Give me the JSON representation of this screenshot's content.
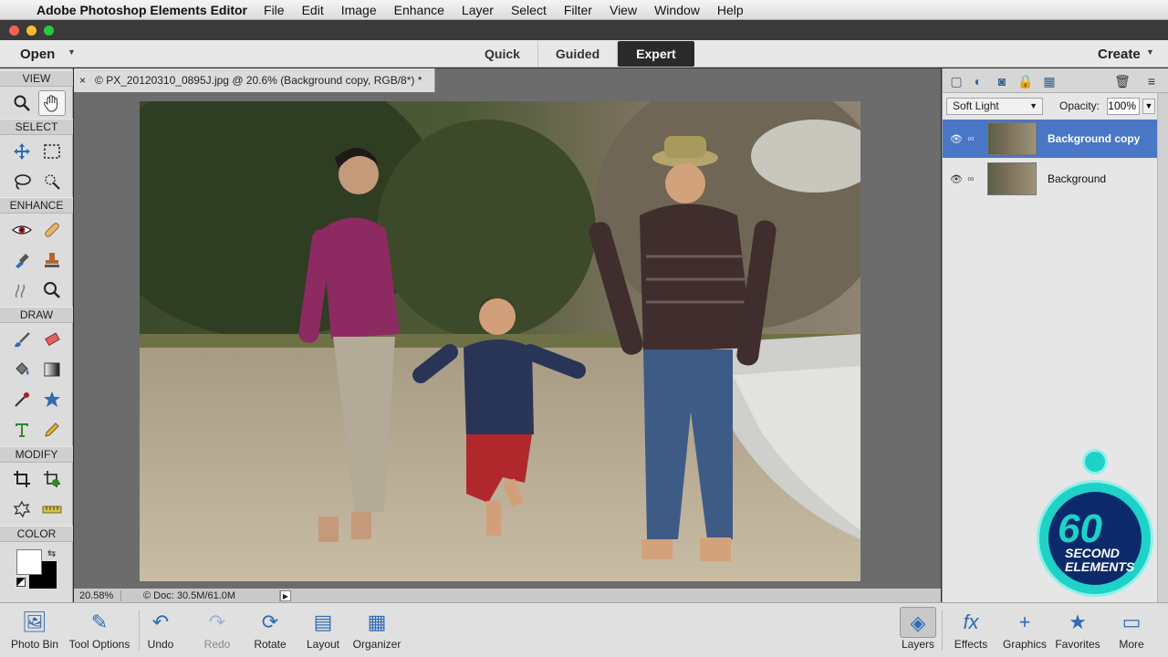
{
  "menubar": {
    "app_name": "Adobe Photoshop Elements Editor",
    "items": [
      "File",
      "Edit",
      "Image",
      "Enhance",
      "Layer",
      "Select",
      "Filter",
      "View",
      "Window",
      "Help"
    ]
  },
  "modebar": {
    "open_label": "Open",
    "modes": [
      "Quick",
      "Guided",
      "Expert"
    ],
    "active_mode": "Expert",
    "create_label": "Create"
  },
  "toolpanel": {
    "sections": {
      "view": "VIEW",
      "select": "SELECT",
      "enhance": "ENHANCE",
      "draw": "DRAW",
      "modify": "MODIFY",
      "color": "COLOR"
    }
  },
  "document": {
    "tab_title": "© PX_20120310_0895J.jpg @ 20.6% (Background copy, RGB/8*) *",
    "zoom": "20.58%",
    "doc_info": "© Doc: 30.5M/61.0M"
  },
  "layers": {
    "blend_mode": "Soft Light",
    "opacity_label": "Opacity:",
    "opacity_value": "100%",
    "items": [
      {
        "name": "Background copy",
        "selected": true
      },
      {
        "name": "Background",
        "selected": false
      }
    ]
  },
  "badge": {
    "number": "60",
    "text_line1": "SECOND",
    "text_line2": "ELEMENTS"
  },
  "taskbar": {
    "photo_bin": "Photo Bin",
    "tool_options": "Tool Options",
    "undo": "Undo",
    "redo": "Redo",
    "rotate": "Rotate",
    "layout": "Layout",
    "organizer": "Organizer",
    "layers": "Layers",
    "effects": "Effects",
    "graphics": "Graphics",
    "favorites": "Favorites",
    "more": "More"
  },
  "colors": {
    "accent": "#4a76c6",
    "badge": "#1ed2c8"
  }
}
